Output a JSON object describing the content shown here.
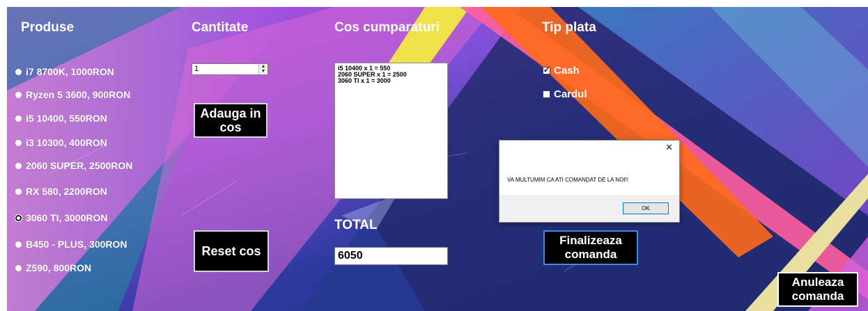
{
  "headers": {
    "products": "Produse",
    "quantity": "Cantitate",
    "cart": "Cos cumparaturi",
    "payment": "Tip plata"
  },
  "products": [
    {
      "label": "i7 8700K, 1000RON",
      "selected": false
    },
    {
      "label": "Ryzen 5 3600, 900RON",
      "selected": false
    },
    {
      "label": "i5 10400, 550RON",
      "selected": false
    },
    {
      "label": "i3 10300, 400RON",
      "selected": false
    },
    {
      "label": "2060 SUPER, 2500RON",
      "selected": false
    },
    {
      "label": "RX 580, 2200RON",
      "selected": false
    },
    {
      "label": "3060 TI, 3000RON",
      "selected": true
    },
    {
      "label": "B450 - PLUS, 300RON",
      "selected": false
    },
    {
      "label": "Z590, 800RON",
      "selected": false
    }
  ],
  "quantity": {
    "value": "1"
  },
  "buttons": {
    "add_to_cart": "Adauga in cos",
    "reset_cart": "Reset cos",
    "finalize": "Finalizeaza comanda",
    "cancel": "Anuleaza comanda"
  },
  "cart": {
    "items": [
      "i5 10400  x 1 = 550",
      "2060 SUPER  x 1 = 2500",
      "3060 TI  x 1 = 3000"
    ]
  },
  "total": {
    "label": "TOTAL",
    "value": "6050"
  },
  "payment": {
    "cash": {
      "label": "Cash",
      "checked": true
    },
    "card": {
      "label": "Cardul",
      "checked": false
    }
  },
  "dialog": {
    "message": "VA MULTUMIM CA ATI COMANDAT DE LA NOI!!",
    "ok": "OK",
    "close_glyph": "✕"
  }
}
